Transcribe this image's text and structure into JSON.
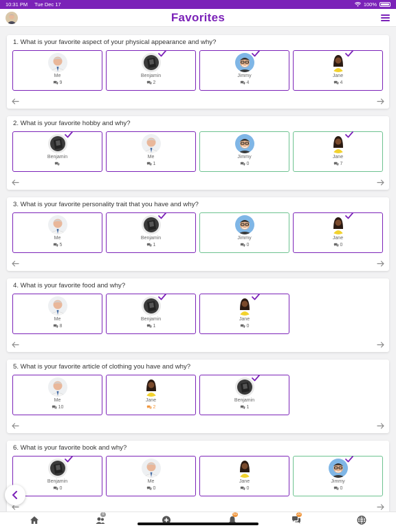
{
  "status": {
    "time": "10:31 PM",
    "date": "Tue Dec 17",
    "battery": "100%"
  },
  "header": {
    "title": "Favorites"
  },
  "colors": {
    "brand": "#7b22b8",
    "green_border": "#6cc28f",
    "orange_count": "#f0963c",
    "badge_orange": "#f0963c"
  },
  "icons": {
    "menu": "menu-icon",
    "back": "chevron-left-icon",
    "prev": "arrow-left-icon",
    "next": "arrow-right-icon",
    "comments": "comments-icon",
    "check": "check-icon"
  },
  "questions": [
    {
      "title": "1. What is your favorite aspect of your physical appearance and why?",
      "entries": [
        {
          "name": "Me",
          "avatar": "me",
          "count": "9",
          "checked": false,
          "border": "purple",
          "count_color": "gray"
        },
        {
          "name": "Benjamin",
          "avatar": "benjamin",
          "count": "2",
          "checked": true,
          "border": "purple",
          "count_color": "gray"
        },
        {
          "name": "Jimmy",
          "avatar": "jimmy",
          "count": "4",
          "checked": true,
          "border": "purple",
          "count_color": "gray"
        },
        {
          "name": "Jane",
          "avatar": "jane",
          "count": "4",
          "checked": true,
          "border": "purple",
          "count_color": "gray"
        }
      ]
    },
    {
      "title": "2. What is your favorite hobby and why?",
      "entries": [
        {
          "name": "Benjamin",
          "avatar": "benjamin",
          "count": "",
          "checked": true,
          "border": "purple",
          "count_color": "gray"
        },
        {
          "name": "Me",
          "avatar": "me",
          "count": "1",
          "checked": false,
          "border": "purple",
          "count_color": "gray"
        },
        {
          "name": "Jimmy",
          "avatar": "jimmy",
          "count": "0",
          "checked": false,
          "border": "green",
          "count_color": "gray"
        },
        {
          "name": "Jane",
          "avatar": "jane",
          "count": "7",
          "checked": true,
          "border": "green",
          "count_color": "gray"
        }
      ]
    },
    {
      "title": "3. What is your favorite personality trait that you have and why?",
      "entries": [
        {
          "name": "Me",
          "avatar": "me",
          "count": "5",
          "checked": false,
          "border": "purple",
          "count_color": "gray"
        },
        {
          "name": "Benjamin",
          "avatar": "benjamin",
          "count": "1",
          "checked": true,
          "border": "purple",
          "count_color": "gray"
        },
        {
          "name": "Jimmy",
          "avatar": "jimmy",
          "count": "0",
          "checked": false,
          "border": "green",
          "count_color": "gray"
        },
        {
          "name": "Jane",
          "avatar": "jane",
          "count": "0",
          "checked": true,
          "border": "purple",
          "count_color": "gray"
        }
      ]
    },
    {
      "title": "4. What is your favorite food and why?",
      "entries": [
        {
          "name": "Me",
          "avatar": "me",
          "count": "8",
          "checked": false,
          "border": "purple",
          "count_color": "gray"
        },
        {
          "name": "Benjamin",
          "avatar": "benjamin",
          "count": "1",
          "checked": true,
          "border": "purple",
          "count_color": "gray"
        },
        {
          "name": "Jane",
          "avatar": "jane",
          "count": "0",
          "checked": true,
          "border": "purple",
          "count_color": "gray"
        }
      ]
    },
    {
      "title": "5. What is your favorite article of clothing you have and why?",
      "entries": [
        {
          "name": "Me",
          "avatar": "me",
          "count": "10",
          "checked": false,
          "border": "purple",
          "count_color": "gray"
        },
        {
          "name": "Jane",
          "avatar": "jane",
          "count": "2",
          "checked": false,
          "border": "purple",
          "count_color": "orange"
        },
        {
          "name": "Benjamin",
          "avatar": "benjamin",
          "count": "1",
          "checked": true,
          "border": "purple",
          "count_color": "gray"
        }
      ]
    },
    {
      "title": "6. What is your favorite book and why?",
      "entries": [
        {
          "name": "Benjamin",
          "avatar": "benjamin",
          "count": "0",
          "checked": true,
          "border": "purple",
          "count_color": "gray"
        },
        {
          "name": "Me",
          "avatar": "me",
          "count": "0",
          "checked": false,
          "border": "purple",
          "count_color": "gray"
        },
        {
          "name": "Jane",
          "avatar": "jane",
          "count": "0",
          "checked": false,
          "border": "purple",
          "count_color": "gray"
        },
        {
          "name": "Jimmy",
          "avatar": "jimmy",
          "count": "0",
          "checked": true,
          "border": "green",
          "count_color": "gray"
        }
      ]
    }
  ],
  "tabbar": {
    "tabs": [
      {
        "icon": "home-icon",
        "badge": ""
      },
      {
        "icon": "people-icon",
        "badge": "0"
      },
      {
        "icon": "add-icon",
        "badge": ""
      },
      {
        "icon": "bell-icon",
        "badge": "61"
      },
      {
        "icon": "chat-icon",
        "badge": "22"
      },
      {
        "icon": "globe-icon",
        "badge": ""
      }
    ]
  }
}
